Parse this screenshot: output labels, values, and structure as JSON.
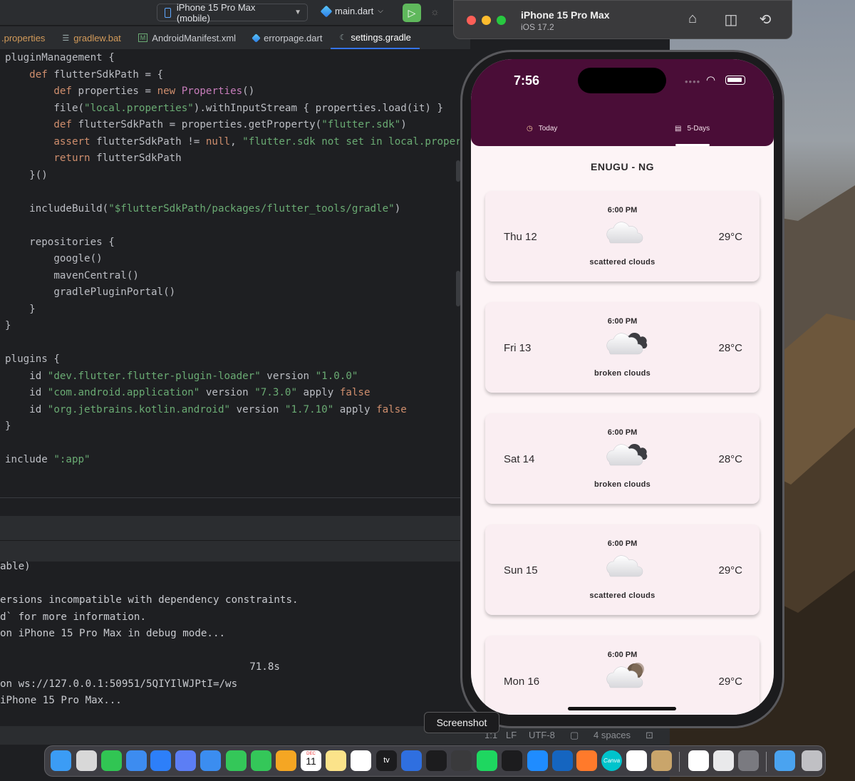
{
  "ide": {
    "device_selector": "iPhone 15 Pro Max (mobile)",
    "run_config": "main.dart",
    "tabs": [
      ".properties",
      "gradlew.bat",
      "AndroidManifest.xml",
      "errorpage.dart",
      "settings.gradle"
    ],
    "code_lines": [
      [
        {
          "t": "pluginManagement {",
          "c": ""
        }
      ],
      [
        {
          "t": "    ",
          "c": ""
        },
        {
          "t": "def",
          "c": "kw"
        },
        {
          "t": " flutterSdkPath = {",
          "c": ""
        }
      ],
      [
        {
          "t": "        ",
          "c": ""
        },
        {
          "t": "def",
          "c": "kw"
        },
        {
          "t": " properties = ",
          "c": ""
        },
        {
          "t": "new",
          "c": "kw"
        },
        {
          "t": " ",
          "c": ""
        },
        {
          "t": "Properties",
          "c": "fn"
        },
        {
          "t": "()",
          "c": ""
        }
      ],
      [
        {
          "t": "        file(",
          "c": ""
        },
        {
          "t": "\"local.properties\"",
          "c": "str"
        },
        {
          "t": ").withInputStream { properties.load(it) }",
          "c": ""
        }
      ],
      [
        {
          "t": "        ",
          "c": ""
        },
        {
          "t": "def",
          "c": "kw"
        },
        {
          "t": " flutterSdkPath = properties.getProperty(",
          "c": ""
        },
        {
          "t": "\"flutter.sdk\"",
          "c": "str"
        },
        {
          "t": ")",
          "c": ""
        }
      ],
      [
        {
          "t": "        ",
          "c": ""
        },
        {
          "t": "assert",
          "c": "kw"
        },
        {
          "t": " flutterSdkPath != ",
          "c": ""
        },
        {
          "t": "null",
          "c": "kw"
        },
        {
          "t": ", ",
          "c": ""
        },
        {
          "t": "\"flutter.sdk not set in local.properti",
          "c": "str"
        }
      ],
      [
        {
          "t": "        ",
          "c": ""
        },
        {
          "t": "return",
          "c": "kw"
        },
        {
          "t": " flutterSdkPath",
          "c": ""
        }
      ],
      [
        {
          "t": "    }()",
          "c": ""
        }
      ],
      [
        {
          "t": "",
          "c": ""
        }
      ],
      [
        {
          "t": "    includeBuild(",
          "c": ""
        },
        {
          "t": "\"$flutterSdkPath/packages/flutter_tools/gradle\"",
          "c": "str"
        },
        {
          "t": ")",
          "c": ""
        }
      ],
      [
        {
          "t": "",
          "c": ""
        }
      ],
      [
        {
          "t": "    repositories {",
          "c": ""
        }
      ],
      [
        {
          "t": "        google()",
          "c": ""
        }
      ],
      [
        {
          "t": "        mavenCentral()",
          "c": ""
        }
      ],
      [
        {
          "t": "        gradlePluginPortal()",
          "c": ""
        }
      ],
      [
        {
          "t": "    }",
          "c": ""
        }
      ],
      [
        {
          "t": "}",
          "c": ""
        }
      ],
      [
        {
          "t": "",
          "c": ""
        }
      ],
      [
        {
          "t": "plugins {",
          "c": ""
        }
      ],
      [
        {
          "t": "    id ",
          "c": ""
        },
        {
          "t": "\"dev.flutter.flutter-plugin-loader\"",
          "c": "str"
        },
        {
          "t": " version ",
          "c": ""
        },
        {
          "t": "\"1.0.0\"",
          "c": "str"
        }
      ],
      [
        {
          "t": "    id ",
          "c": ""
        },
        {
          "t": "\"com.android.application\"",
          "c": "str"
        },
        {
          "t": " version ",
          "c": ""
        },
        {
          "t": "\"7.3.0\"",
          "c": "str"
        },
        {
          "t": " apply ",
          "c": ""
        },
        {
          "t": "false",
          "c": "kw"
        }
      ],
      [
        {
          "t": "    id ",
          "c": ""
        },
        {
          "t": "\"org.jetbrains.kotlin.android\"",
          "c": "str"
        },
        {
          "t": " version ",
          "c": ""
        },
        {
          "t": "\"1.7.10\"",
          "c": "str"
        },
        {
          "t": " apply ",
          "c": ""
        },
        {
          "t": "false",
          "c": "kw"
        }
      ],
      [
        {
          "t": "}",
          "c": ""
        }
      ],
      [
        {
          "t": "",
          "c": ""
        }
      ],
      [
        {
          "t": "include ",
          "c": ""
        },
        {
          "t": "\":app\"",
          "c": "str"
        }
      ]
    ],
    "console_lines": [
      "able)",
      "",
      "ersions incompatible with dependency constraints.",
      "d` for more information.",
      "on iPhone 15 Pro Max in debug mode...",
      "",
      "                                         71.8s",
      "on ws://127.0.0.1:50951/5QIYIlWJPtI=/ws",
      "iPhone 15 Pro Max..."
    ],
    "status": {
      "pos": "1:1",
      "lf": "LF",
      "enc": "UTF-8",
      "indent": "4 spaces"
    }
  },
  "simulator": {
    "title": "iPhone 15 Pro Max",
    "subtitle": "iOS 17.2",
    "icons": [
      "home-icon",
      "screenshot-icon",
      "rotate-icon"
    ]
  },
  "app": {
    "status_time": "7:56",
    "tabs": [
      "Today",
      "5-Days"
    ],
    "selected_tab": "5-Days",
    "city": "ENUGU - NG",
    "forecast": [
      {
        "day": "Thu 12",
        "time": "6:00 PM",
        "temp": "29°C",
        "desc": "scattered clouds",
        "icon": "scattered-clouds"
      },
      {
        "day": "Fri 13",
        "time": "6:00 PM",
        "temp": "28°C",
        "desc": "broken clouds",
        "icon": "broken-clouds"
      },
      {
        "day": "Sat 14",
        "time": "6:00 PM",
        "temp": "28°C",
        "desc": "broken clouds",
        "icon": "broken-clouds"
      },
      {
        "day": "Sun 15",
        "time": "6:00 PM",
        "temp": "29°C",
        "desc": "scattered clouds",
        "icon": "scattered-clouds"
      },
      {
        "day": "Mon 16",
        "time": "6:00 PM",
        "temp": "29°C",
        "desc": "",
        "icon": "few-clouds-night"
      }
    ],
    "colors": {
      "appbar": "#4a0d37",
      "background": "#fdf4f6",
      "card": "#faeef2"
    }
  },
  "tooltip": "Screenshot",
  "dock": {
    "icons": [
      "finder-icon",
      "chess-icon",
      "whatsapp-icon",
      "safari-icon",
      "xcode-instruments-icon",
      "xcode-icon",
      "mail-icon",
      "facetime-icon",
      "messages-icon",
      "photos-icon",
      "calendar-icon",
      "notes-icon",
      "freeform-icon",
      "apple-tv-icon",
      "xcode-build-icon",
      "terminal-icon",
      "screenshot-icon",
      "spotify-icon",
      "figma-icon",
      "app-store-icon",
      "outlook-icon",
      "infuse-icon",
      "canva-icon",
      "chrome-icon",
      "archive-icon",
      "textedit-icon",
      "font-book-icon",
      "system-preferences-icon",
      "folder-icon",
      "trash-icon"
    ],
    "calendar_month": "DEC",
    "calendar_day": "11",
    "tv_label": "tv",
    "canva_label": "Canva"
  }
}
